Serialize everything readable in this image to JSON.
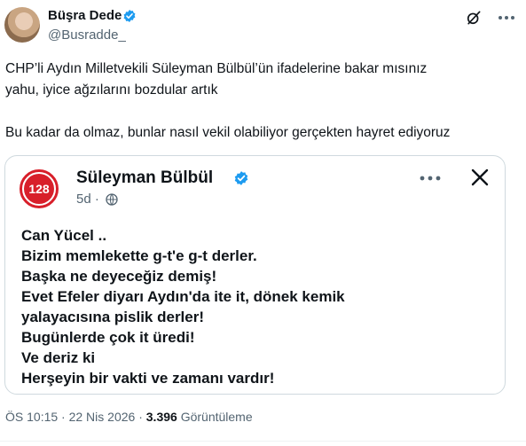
{
  "author": {
    "name": "Büşra Dede",
    "handle": "@Busradde_"
  },
  "tweet": {
    "text": "CHP’li Aydın Milletvekili Süleyman Bülbül’ün ifadelerine bakar mısınız\nyahu, iyice ağzılarını bozdular artık\n\nBu kadar da olmaz, bunlar nasıl vekil olabiliyor gerçekten hayret ediyoruz"
  },
  "quoted_card": {
    "avatar_text": "128",
    "name": "Süleyman Bülbül",
    "time": "5d ·",
    "body": "Can Yücel ..\nBizim memlekette g-t'e g-t derler.\nBaşka ne deyeceğiz demiş!\nEvet Efeler diyarı Aydın'da ite it, dönek kemik\nyalayacısına pislik derler!\nBugünlerde çok it üredi!\nVe deriz ki\nHerşeyin bir vakti ve zamanı vardır!"
  },
  "meta": {
    "time_date": "ÖS 10:15 · 22 Nis 2026 · ",
    "views_count": "3.396",
    "views_label": " Görüntüleme"
  },
  "colors": {
    "verified_blue": "#1d9bf0",
    "card_red": "#d81f2a",
    "muted_text": "#536471"
  },
  "icons": {
    "verified": "verified-badge-icon",
    "grok": "grok-icon",
    "more": "more-horizontal-icon",
    "globe": "globe-icon",
    "close": "close-icon"
  }
}
